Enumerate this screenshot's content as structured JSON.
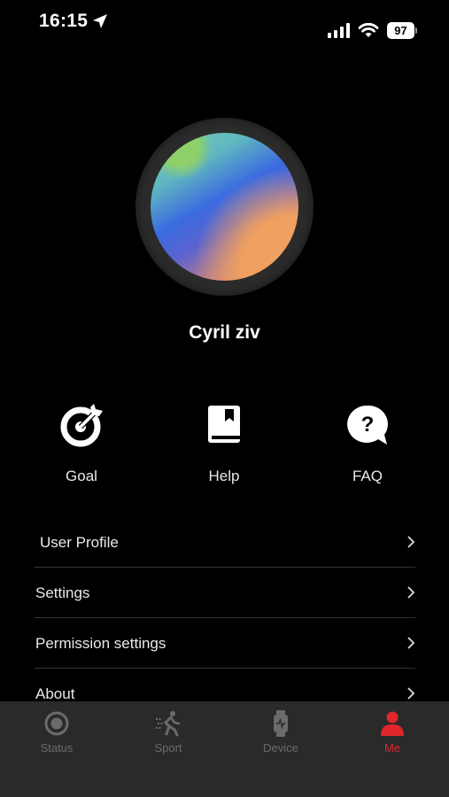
{
  "status_bar": {
    "time": "16:15",
    "battery": "97"
  },
  "profile": {
    "name": "Cyril ziv"
  },
  "quick_actions": [
    {
      "label": "Goal",
      "icon": "goal-target-icon"
    },
    {
      "label": "Help",
      "icon": "help-book-icon"
    },
    {
      "label": "FAQ",
      "icon": "faq-question-icon"
    }
  ],
  "menu": [
    {
      "label": "User Profile"
    },
    {
      "label": "Settings"
    },
    {
      "label": "Permission settings"
    },
    {
      "label": "About"
    }
  ],
  "tabs": [
    {
      "label": "Status",
      "icon": "status-circle-icon",
      "active": false
    },
    {
      "label": "Sport",
      "icon": "runner-icon",
      "active": false
    },
    {
      "label": "Device",
      "icon": "watch-icon",
      "active": false
    },
    {
      "label": "Me",
      "icon": "person-icon",
      "active": true
    }
  ],
  "colors": {
    "background": "#000000",
    "tabbar": "#2a2a2a",
    "accent": "#e0262a",
    "inactive_tab": "#6b6b6b"
  }
}
